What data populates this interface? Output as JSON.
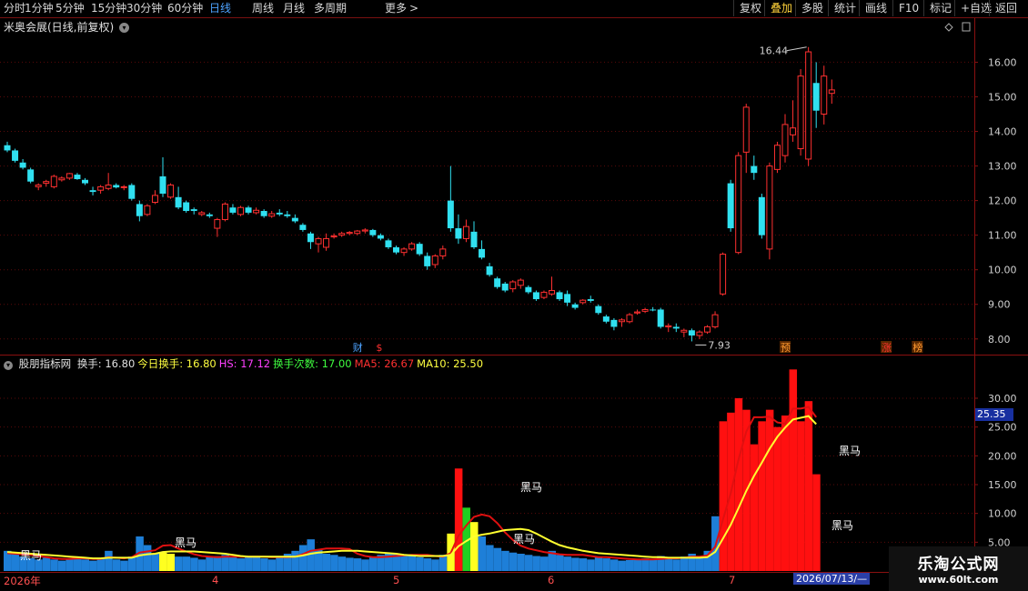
{
  "toolbar": {
    "periods": [
      "分时",
      "1分钟",
      "5分钟",
      "15分钟",
      "30分钟",
      "60分钟",
      "日线",
      "周线",
      "月线",
      "多周期",
      "更多"
    ],
    "active_period": "日线",
    "more_arrow": ">",
    "right_buttons": [
      "复权",
      "叠加",
      "多股",
      "统计",
      "画线",
      "F10",
      "标记",
      "+自选",
      "返回"
    ],
    "highlighted_button": "叠加"
  },
  "main_chart": {
    "title": "米奥会展(日线,前复权)",
    "high_label": "16.44",
    "low_label": "7.93",
    "y_ticks": [
      "16.00",
      "15.00",
      "14.00",
      "13.00",
      "12.00",
      "11.00",
      "10.00",
      "9.00",
      "8.00"
    ],
    "event_markers": [
      {
        "text": "财",
        "color": "#4da3ff"
      },
      {
        "text": "$",
        "color": "#ff3030"
      },
      {
        "text": "预",
        "color": "#ff9a30"
      },
      {
        "text": "涨",
        "color": "#ff3030"
      },
      {
        "text": "榜",
        "color": "#ff9a30"
      }
    ]
  },
  "sub_chart": {
    "name": "股朋指标网",
    "fields": [
      {
        "label": "换手: 16.80",
        "color": "#e0e0e0"
      },
      {
        "label": "今日换手: 16.80",
        "color": "#ffff40"
      },
      {
        "label": "HS: 17.12",
        "color": "#ff40ff"
      },
      {
        "label": "换手次数: 17.00",
        "color": "#40ff40"
      },
      {
        "label": "MA5: 26.67",
        "color": "#ff3030"
      },
      {
        "label": "MA10: 25.50",
        "color": "#ffff40"
      }
    ],
    "y_ticks": [
      "30.00",
      "25.00",
      "20.00",
      "15.00",
      "10.00",
      "5.00"
    ],
    "current_value_label": "25.35",
    "heima_label": "黑马"
  },
  "x_axis": {
    "labels": [
      "2026年",
      "4",
      "5",
      "6",
      "7"
    ],
    "cursor_date": "2026/07/13/—"
  },
  "watermark": {
    "title": "乐淘公式网",
    "url": "www.60lt.com"
  },
  "chart_data": {
    "type": "candlestick",
    "ohlc": [
      [
        13.6,
        13.7,
        13.4,
        13.45
      ],
      [
        13.45,
        13.5,
        13.1,
        13.15
      ],
      [
        13.1,
        13.2,
        12.9,
        12.95
      ],
      [
        12.9,
        12.95,
        12.5,
        12.55
      ],
      [
        12.4,
        12.5,
        12.3,
        12.45
      ],
      [
        12.5,
        12.6,
        12.4,
        12.55
      ],
      [
        12.4,
        12.75,
        12.35,
        12.7
      ],
      [
        12.6,
        12.7,
        12.55,
        12.65
      ],
      [
        12.65,
        12.8,
        12.6,
        12.78
      ],
      [
        12.75,
        12.8,
        12.6,
        12.62
      ],
      [
        12.6,
        12.65,
        12.45,
        12.5
      ],
      [
        12.3,
        12.4,
        12.15,
        12.25
      ],
      [
        12.3,
        12.45,
        12.2,
        12.4
      ],
      [
        12.35,
        12.8,
        12.3,
        12.45
      ],
      [
        12.45,
        12.5,
        12.35,
        12.38
      ],
      [
        12.38,
        12.45,
        12.3,
        12.4
      ],
      [
        12.45,
        12.5,
        12.0,
        12.05
      ],
      [
        11.9,
        12.0,
        11.4,
        11.55
      ],
      [
        11.6,
        11.9,
        11.55,
        11.85
      ],
      [
        11.95,
        12.3,
        11.9,
        12.15
      ],
      [
        12.7,
        13.25,
        12.1,
        12.2
      ],
      [
        12.1,
        12.5,
        12.05,
        12.45
      ],
      [
        12.1,
        12.4,
        11.75,
        11.8
      ],
      [
        11.95,
        12.0,
        11.65,
        11.7
      ],
      [
        11.75,
        11.8,
        11.6,
        11.7
      ],
      [
        11.6,
        11.7,
        11.55,
        11.65
      ],
      [
        11.6,
        11.65,
        11.5,
        11.55
      ],
      [
        11.2,
        11.5,
        10.95,
        11.45
      ],
      [
        11.45,
        11.95,
        11.4,
        11.9
      ],
      [
        11.8,
        11.9,
        11.6,
        11.65
      ],
      [
        11.6,
        11.85,
        11.55,
        11.8
      ],
      [
        11.8,
        11.85,
        11.6,
        11.65
      ],
      [
        11.65,
        11.8,
        11.6,
        11.72
      ],
      [
        11.7,
        11.75,
        11.5,
        11.55
      ],
      [
        11.55,
        11.7,
        11.5,
        11.62
      ],
      [
        11.65,
        11.75,
        11.55,
        11.6
      ],
      [
        11.6,
        11.7,
        11.5,
        11.55
      ],
      [
        11.5,
        11.6,
        11.35,
        11.4
      ],
      [
        11.3,
        11.35,
        11.1,
        11.15
      ],
      [
        11.05,
        11.1,
        10.6,
        10.8
      ],
      [
        10.75,
        10.95,
        10.5,
        10.9
      ],
      [
        10.65,
        11.05,
        10.55,
        10.9
      ],
      [
        10.95,
        11.05,
        10.9,
        10.98
      ],
      [
        11.0,
        11.1,
        10.95,
        11.05
      ],
      [
        11.05,
        11.12,
        11.0,
        11.08
      ],
      [
        11.05,
        11.15,
        11.0,
        11.12
      ],
      [
        11.12,
        11.2,
        11.05,
        11.15
      ],
      [
        11.15,
        11.18,
        10.95,
        11.0
      ],
      [
        11.0,
        11.05,
        10.85,
        10.9
      ],
      [
        10.85,
        10.9,
        10.6,
        10.65
      ],
      [
        10.65,
        10.7,
        10.45,
        10.5
      ],
      [
        10.5,
        10.65,
        10.4,
        10.6
      ],
      [
        10.6,
        10.8,
        10.55,
        10.75
      ],
      [
        10.75,
        10.8,
        10.4,
        10.45
      ],
      [
        10.4,
        10.5,
        10.0,
        10.1
      ],
      [
        10.15,
        10.45,
        10.05,
        10.4
      ],
      [
        10.4,
        10.7,
        10.3,
        10.6
      ],
      [
        12.0,
        13.0,
        11.1,
        11.2
      ],
      [
        11.2,
        11.6,
        10.75,
        10.9
      ],
      [
        10.9,
        11.45,
        10.8,
        11.25
      ],
      [
        11.1,
        11.4,
        10.6,
        10.65
      ],
      [
        10.6,
        10.85,
        10.3,
        10.35
      ],
      [
        10.1,
        10.2,
        9.8,
        9.85
      ],
      [
        9.75,
        9.8,
        9.45,
        9.5
      ],
      [
        9.6,
        9.65,
        9.35,
        9.4
      ],
      [
        9.45,
        9.7,
        9.35,
        9.65
      ],
      [
        9.55,
        9.75,
        9.45,
        9.7
      ],
      [
        9.5,
        9.55,
        9.3,
        9.35
      ],
      [
        9.35,
        9.4,
        9.1,
        9.15
      ],
      [
        9.2,
        9.4,
        9.15,
        9.35
      ],
      [
        9.3,
        9.8,
        9.25,
        9.4
      ],
      [
        9.35,
        9.4,
        9.1,
        9.15
      ],
      [
        9.3,
        9.4,
        8.95,
        9.05
      ],
      [
        9.0,
        9.05,
        8.85,
        8.9
      ],
      [
        9.05,
        9.15,
        9.0,
        9.12
      ],
      [
        9.15,
        9.25,
        9.05,
        9.1
      ],
      [
        8.95,
        9.0,
        8.7,
        8.75
      ],
      [
        8.65,
        8.7,
        8.45,
        8.5
      ],
      [
        8.55,
        8.6,
        8.25,
        8.35
      ],
      [
        8.5,
        8.6,
        8.35,
        8.55
      ],
      [
        8.5,
        8.75,
        8.45,
        8.7
      ],
      [
        8.75,
        8.85,
        8.7,
        8.78
      ],
      [
        8.8,
        8.9,
        8.75,
        8.85
      ],
      [
        8.85,
        8.92,
        8.8,
        8.83
      ],
      [
        8.85,
        8.9,
        8.3,
        8.35
      ],
      [
        8.35,
        8.45,
        8.2,
        8.38
      ],
      [
        8.35,
        8.45,
        8.2,
        8.3
      ],
      [
        8.2,
        8.3,
        8.05,
        8.25
      ],
      [
        8.25,
        8.3,
        7.93,
        8.1
      ],
      [
        8.1,
        8.25,
        8.0,
        8.2
      ],
      [
        8.2,
        8.4,
        8.15,
        8.35
      ],
      [
        8.35,
        8.8,
        8.3,
        8.7
      ],
      [
        9.3,
        10.5,
        9.25,
        10.45
      ],
      [
        12.5,
        12.6,
        11.1,
        11.2
      ],
      [
        10.5,
        13.4,
        10.45,
        13.3
      ],
      [
        13.4,
        14.8,
        12.8,
        14.7
      ],
      [
        13.0,
        13.3,
        12.6,
        12.8
      ],
      [
        12.1,
        12.2,
        10.9,
        11.0
      ],
      [
        10.6,
        13.1,
        10.3,
        13.0
      ],
      [
        12.9,
        13.7,
        12.8,
        13.6
      ],
      [
        13.3,
        14.5,
        13.1,
        14.2
      ],
      [
        13.9,
        14.9,
        13.7,
        14.1
      ],
      [
        13.5,
        15.8,
        13.3,
        15.6
      ],
      [
        13.2,
        16.44,
        13.0,
        16.3
      ],
      [
        15.4,
        16.0,
        14.1,
        14.6
      ],
      [
        14.5,
        15.9,
        14.2,
        15.6
      ],
      [
        15.1,
        15.5,
        14.8,
        15.2
      ]
    ],
    "turnover": [
      3.5,
      3.0,
      2.5,
      2.2,
      2.0,
      2.3,
      2.0,
      1.8,
      2.2,
      2.5,
      2.0,
      1.8,
      2.1,
      3.5,
      2.0,
      1.8,
      2.5,
      6.0,
      4.5,
      3.0,
      3.2,
      3.0,
      2.5,
      2.5,
      2.3,
      2.0,
      2.4,
      2.6,
      2.8,
      2.4,
      2.2,
      2.6,
      2.4,
      2.2,
      2.0,
      2.5,
      3.0,
      3.5,
      4.5,
      5.5,
      3.8,
      3.0,
      2.8,
      2.5,
      2.3,
      2.2,
      2.0,
      2.5,
      2.8,
      3.0,
      3.0,
      2.6,
      2.8,
      2.4,
      2.2,
      2.0,
      2.8,
      6.5,
      17.8,
      11.0,
      8.5,
      6.0,
      4.5,
      4.0,
      3.5,
      3.2,
      3.0,
      2.8,
      2.6,
      2.5,
      3.5,
      2.8,
      2.5,
      2.3,
      2.2,
      2.0,
      2.5,
      2.2,
      2.0,
      1.8,
      1.9,
      2.0,
      2.2,
      2.1,
      2.6,
      2.3,
      2.0,
      2.5,
      3.0,
      2.5,
      3.5,
      9.5,
      26.0,
      27.5,
      30.0,
      28.0,
      22.0,
      26.0,
      28.0,
      25.0,
      27.0,
      35.0,
      26.0,
      29.5,
      16.8
    ],
    "turnover_ma5": [
      3.1,
      3.0,
      2.9,
      2.8,
      2.6,
      2.4,
      2.2,
      2.1,
      2.1,
      2.2,
      2.2,
      2.1,
      2.1,
      2.4,
      2.3,
      2.2,
      2.4,
      3.2,
      3.4,
      3.6,
      4.4,
      4.5,
      3.9,
      3.4,
      2.9,
      2.6,
      2.5,
      2.4,
      2.5,
      2.5,
      2.5,
      2.5,
      2.5,
      2.5,
      2.4,
      2.4,
      2.4,
      2.5,
      2.9,
      3.5,
      3.7,
      3.9,
      3.9,
      3.9,
      3.8,
      3.0,
      2.6,
      2.4,
      2.4,
      2.5,
      2.6,
      2.7,
      2.8,
      2.8,
      2.8,
      2.6,
      2.5,
      3.1,
      6.1,
      7.9,
      9.4,
      9.8,
      9.5,
      8.3,
      6.7,
      5.4,
      4.4,
      3.9,
      3.6,
      3.3,
      3.1,
      2.9,
      2.8,
      2.8,
      2.8,
      2.6,
      2.4,
      2.4,
      2.3,
      2.2,
      2.1,
      2.0,
      2.0,
      2.0,
      2.1,
      2.2,
      2.2,
      2.3,
      2.5,
      2.5,
      2.7,
      4.2,
      8.9,
      13.5,
      19.3,
      24.2,
      26.7,
      26.7,
      26.8,
      25.8,
      25.6,
      28.2,
      28.2,
      28.5,
      26.7
    ],
    "turnover_ma10": [
      3.3,
      3.2,
      3.1,
      3.0,
      2.9,
      2.8,
      2.7,
      2.6,
      2.5,
      2.4,
      2.3,
      2.2,
      2.2,
      2.3,
      2.3,
      2.3,
      2.3,
      2.7,
      2.9,
      3.0,
      3.3,
      3.4,
      3.4,
      3.4,
      3.4,
      3.3,
      3.2,
      3.1,
      3.0,
      2.8,
      2.6,
      2.5,
      2.5,
      2.5,
      2.5,
      2.5,
      2.5,
      2.5,
      2.7,
      3.0,
      3.2,
      3.3,
      3.4,
      3.5,
      3.5,
      3.5,
      3.4,
      3.3,
      3.2,
      3.1,
      3.0,
      2.8,
      2.7,
      2.6,
      2.6,
      2.6,
      2.6,
      2.8,
      4.3,
      5.2,
      6.0,
      6.3,
      6.5,
      6.8,
      7.1,
      7.2,
      7.3,
      7.1,
      6.5,
      5.8,
      5.1,
      4.5,
      4.1,
      3.8,
      3.5,
      3.3,
      3.1,
      3.0,
      2.9,
      2.8,
      2.7,
      2.6,
      2.5,
      2.4,
      2.4,
      2.3,
      2.3,
      2.3,
      2.3,
      2.3,
      2.4,
      3.3,
      5.6,
      8.0,
      10.9,
      13.9,
      16.5,
      18.8,
      21.2,
      23.3,
      24.9,
      26.3,
      26.6,
      26.9,
      25.5
    ],
    "heima_bars": [
      2,
      25,
      78,
      82,
      123,
      124
    ],
    "y_range_price": [
      7.6,
      16.8
    ],
    "y_range_turnover": [
      0,
      36
    ]
  }
}
